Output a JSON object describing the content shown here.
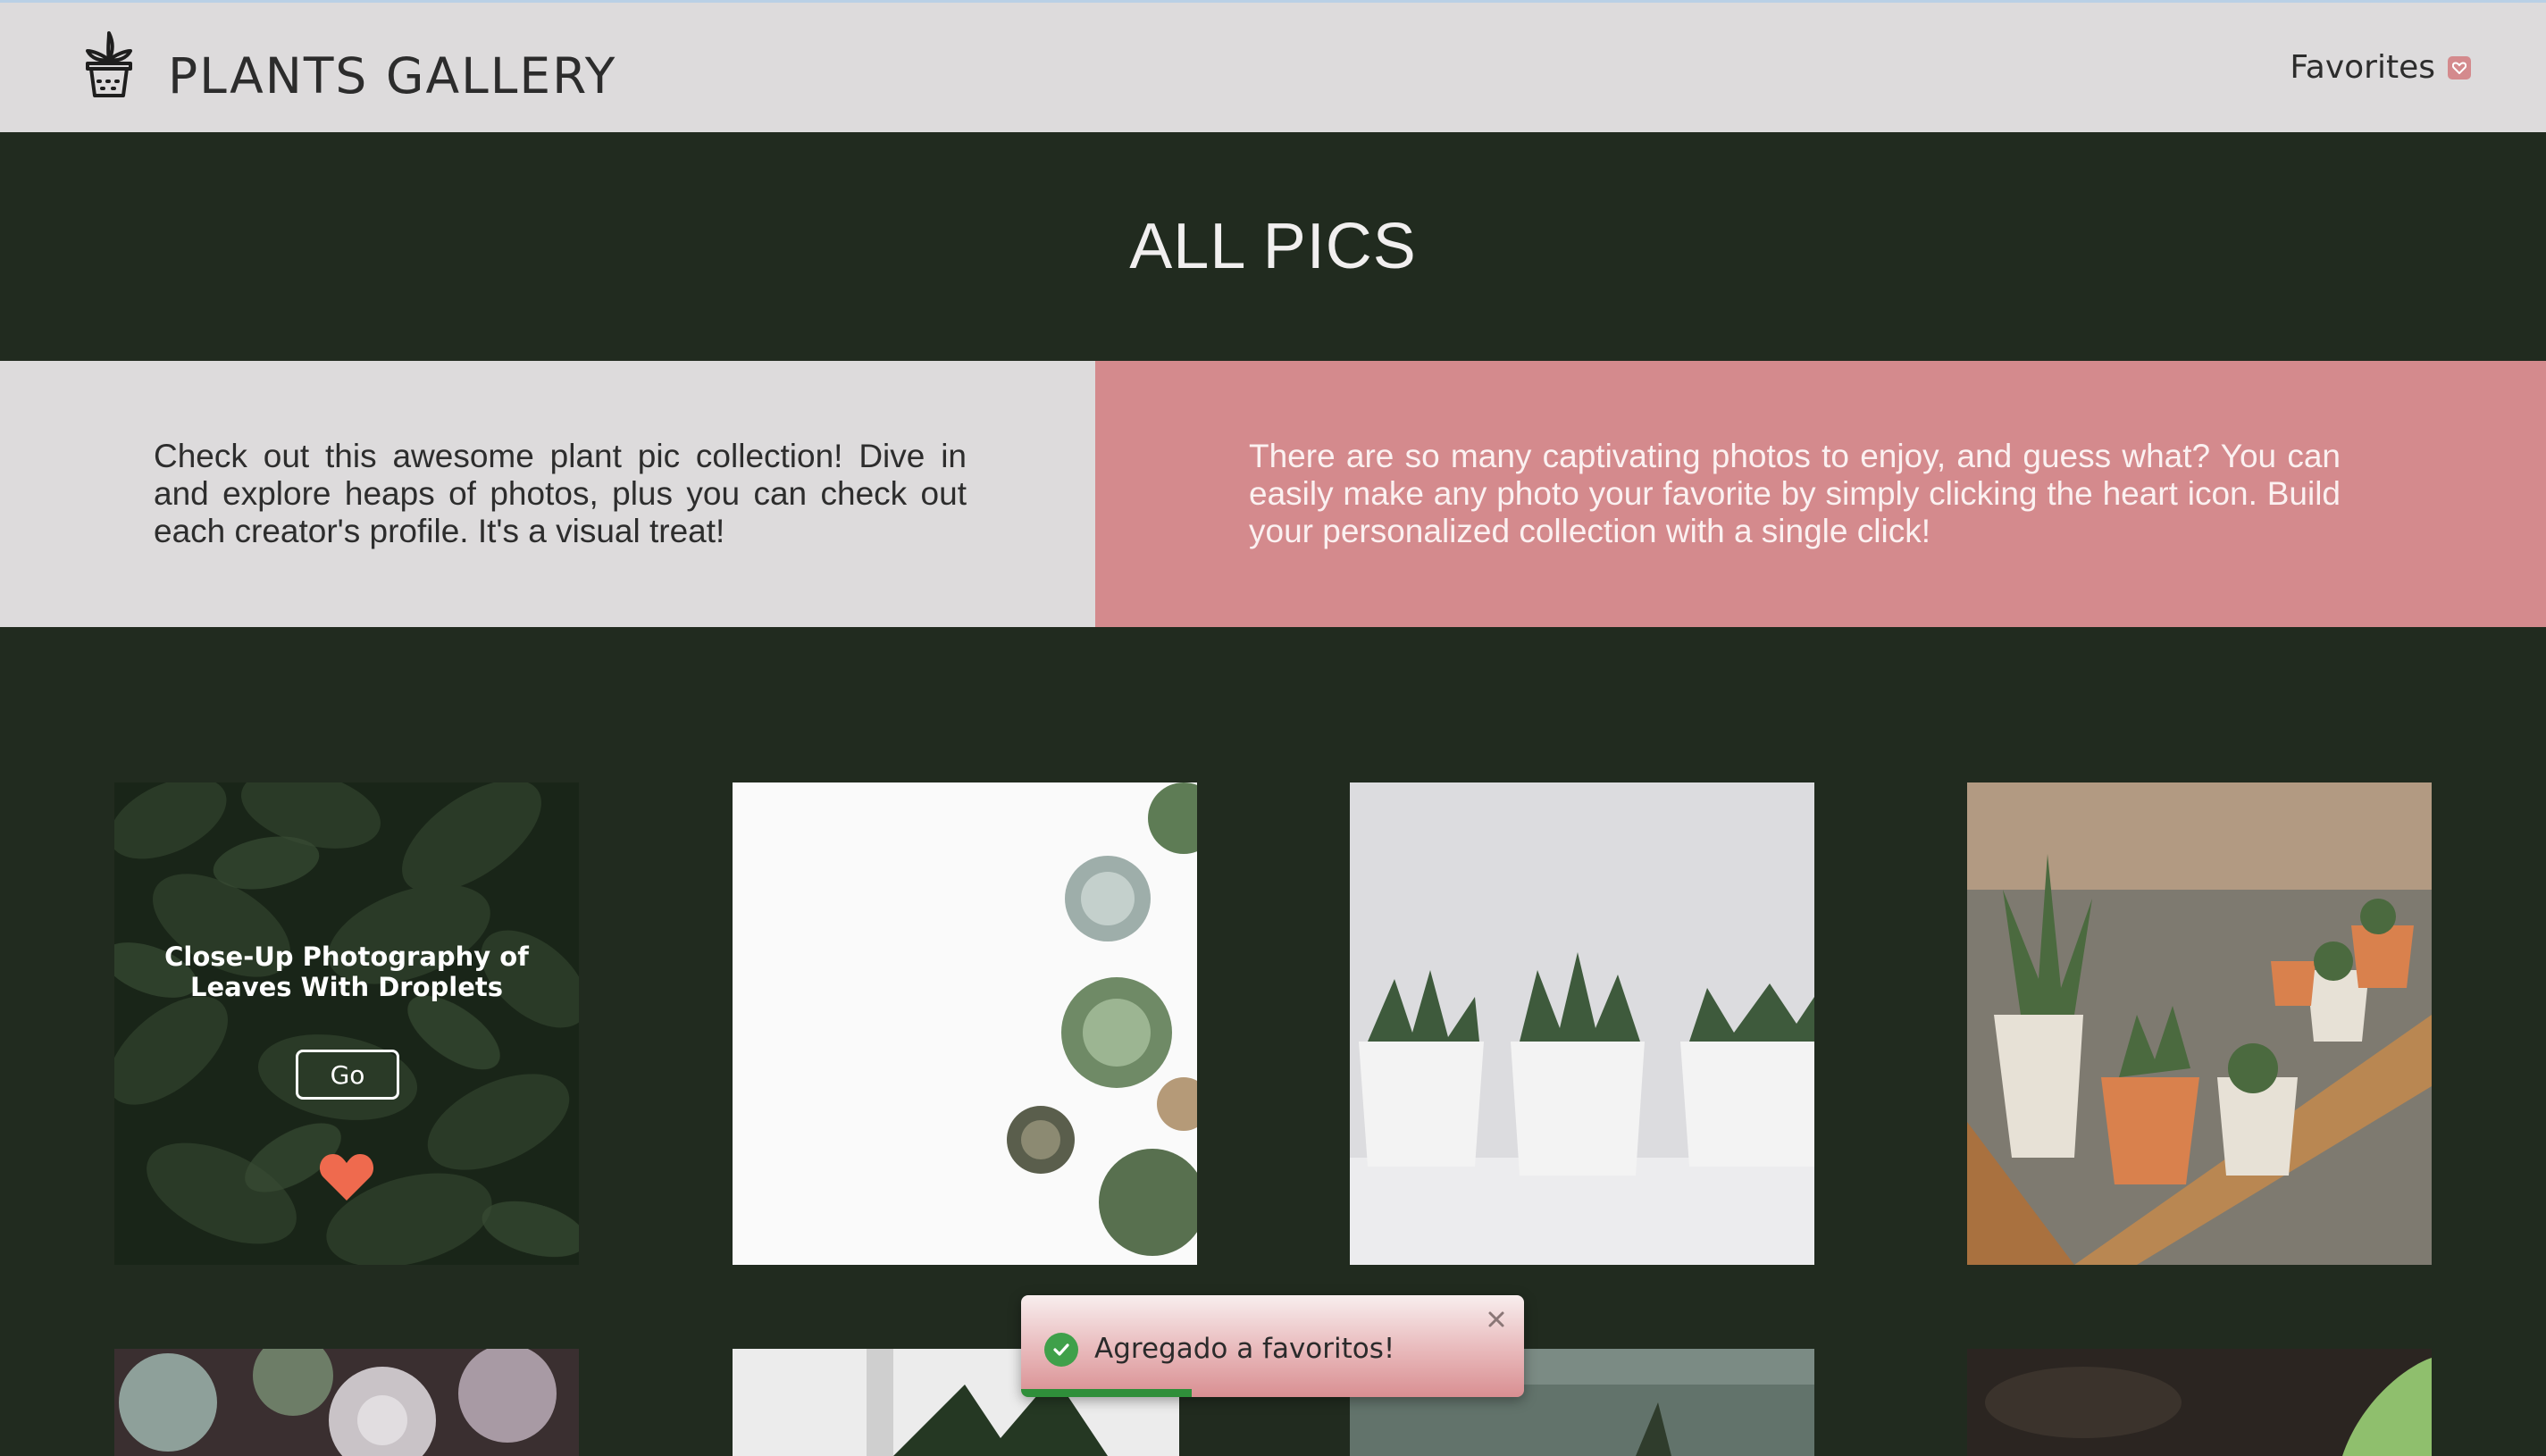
{
  "header": {
    "brand": "PLANTS GALLERY",
    "favorites_label": "Favorites"
  },
  "hero": {
    "title": "ALL PICS"
  },
  "info": {
    "left_text": "Check out this awesome plant pic collection! Dive in and explore heaps of photos, plus you can check out each creator's profile. It's a visual treat!",
    "right_text": "There are so many captivating photos to enjoy, and guess what? You can easily make any photo your favorite by simply clicking the heart icon. Build your personalized collection with a single click!"
  },
  "gallery": {
    "cards": [
      {
        "title": "Close-Up Photography of Leaves With Droplets",
        "button_label": "Go",
        "favorited": true
      },
      {
        "title": ""
      },
      {
        "title": ""
      },
      {
        "title": ""
      },
      {
        "title": ""
      },
      {
        "title": ""
      },
      {
        "title": ""
      },
      {
        "title": ""
      }
    ]
  },
  "toast": {
    "message": "Agregado a favoritos!",
    "progress": 0.34
  },
  "colors": {
    "header_bg": "#dddbdc",
    "dark_green": "#212b1f",
    "accent_pink": "#d48a8d",
    "heart": "#ef6a4e",
    "success": "#3fa04a"
  },
  "icons": {
    "logo": "potted-plant-icon",
    "favorites": "heart-icon",
    "favorite_toggle": "heart-icon",
    "toast_status": "check-circle-icon",
    "toast_close": "close-icon"
  }
}
